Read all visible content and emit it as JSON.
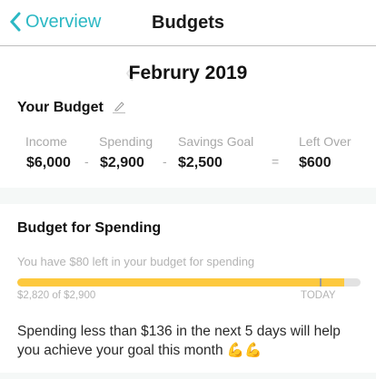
{
  "header": {
    "back_label": "Overview",
    "title": "Budgets"
  },
  "month": {
    "label": "Februry 2019"
  },
  "your_budget": {
    "title": "Your Budget",
    "columns": [
      {
        "label": "Income",
        "value": "$6,000"
      },
      {
        "label": "Spending",
        "value": "$2,900"
      },
      {
        "label": "Savings Goal",
        "value": "$2,500"
      },
      {
        "label": "Left Over",
        "value": "$600"
      }
    ],
    "operators": [
      "-",
      "-",
      "="
    ]
  },
  "spending": {
    "title": "Budget for Spending",
    "subtitle": "You have $80 left in your budget for spending",
    "progress_fraction": 0.953,
    "today_fraction": 0.88,
    "amount_label": "$2,820 of $2,900",
    "today_label": "TODAY",
    "message": "Spending less than $136 in the next 5 days will help you achieve your goal this month 💪💪",
    "bar_color": "#fdc93e"
  },
  "colors": {
    "accent": "#2bb8c4"
  }
}
